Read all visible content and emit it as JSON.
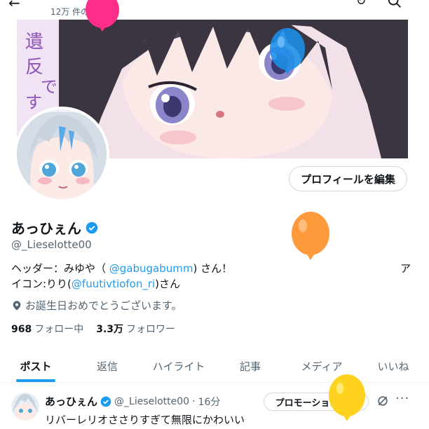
{
  "header": {
    "post_count": "12万 件のポスト",
    "back_icon": "arrow-left-icon",
    "refresh_icon": "refresh-icon",
    "search_icon": "search-icon"
  },
  "banner": {
    "text_overlay": "遺 反 で す"
  },
  "profile": {
    "edit_button": "プロフィールを編集",
    "display_name": "あっひぇん",
    "handle": "@_Lieselotte00",
    "bio_line1_prefix": "ヘッダー：みゆや（ ",
    "bio_link1": "@gabugabumm",
    "bio_line1_suffix": ") さん！",
    "bio_line1_end": "ア",
    "bio_line2_prefix": "イコン:りり(",
    "bio_link2": "@fuutivtiofon_ri",
    "bio_line2_suffix": ")さん",
    "birthday": "お誕生日おめでとうございます。",
    "following_count": "968",
    "following_label": "フォロー中",
    "followers_count": "3.3万",
    "followers_label": "フォロワー",
    "verified_color": "#1d9bf0"
  },
  "tabs": [
    {
      "label": "ポスト",
      "active": true
    },
    {
      "label": "返信",
      "active": false
    },
    {
      "label": "ハイライト",
      "active": false
    },
    {
      "label": "記事",
      "active": false
    },
    {
      "label": "メディア",
      "active": false
    },
    {
      "label": "いいね",
      "active": false
    }
  ],
  "tweet": {
    "name": "あっひぇん",
    "handle": "@_Lieselotte00",
    "separator": "·",
    "time": "16分",
    "promo_button": "プロモーションする",
    "more": "···",
    "text": "リバーレリオささりすぎて無限にかわいい"
  },
  "balloons": {
    "pink": "#ff2d8a",
    "blue": "#1d8fe8",
    "orange": "#ff9a3c",
    "yellow": "#ffd21f"
  }
}
